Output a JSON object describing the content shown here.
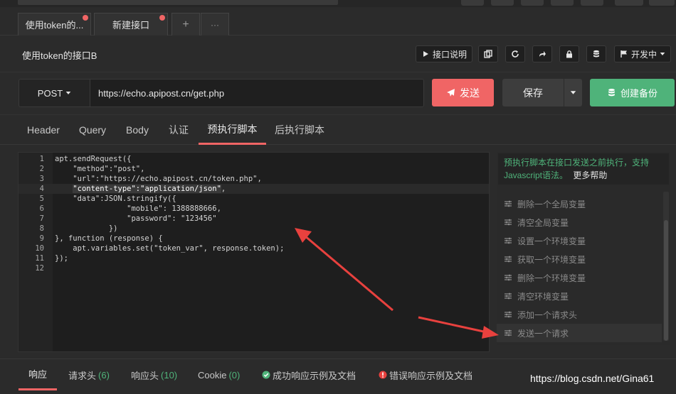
{
  "tabs": [
    {
      "label": "使用token的...",
      "modified": true
    },
    {
      "label": "新建接口",
      "modified": true
    }
  ],
  "tab_add_label": "+",
  "tab_more_label": "···",
  "request": {
    "title": "使用token的接口B",
    "method": "POST",
    "url": "https://echo.apipost.cn/get.php"
  },
  "toolbar": {
    "doc_label": "接口说明",
    "env_label": "开发中"
  },
  "actions": {
    "send_label": "发送",
    "save_label": "保存",
    "backup_label": "创建备份"
  },
  "request_tabs": [
    "Header",
    "Query",
    "Body",
    "认证",
    "预执行脚本",
    "后执行脚本"
  ],
  "active_request_tab": "预执行脚本",
  "code_lines": [
    {
      "n": "1",
      "text": "apt.sendRequest({"
    },
    {
      "n": "2",
      "text": "    \"method\":\"post\","
    },
    {
      "n": "3",
      "text": "    \"url\":\"https://echo.apipost.cn/token.php\","
    },
    {
      "n": "4",
      "pre": "    ",
      "sel": "\"content-type\":\"application/json\"",
      "post": ","
    },
    {
      "n": "5",
      "text": "    \"data\":JSON.stringify({"
    },
    {
      "n": "6",
      "text": "                \"mobile\": 1388888666,"
    },
    {
      "n": "7",
      "text": "                \"password\": \"123456\""
    },
    {
      "n": "8",
      "text": "            })"
    },
    {
      "n": "9",
      "text": "}, function (response) {"
    },
    {
      "n": "10",
      "text": "    apt.variables.set(\"token_var\", response.token);"
    },
    {
      "n": "11",
      "text": "});"
    },
    {
      "n": "12",
      "text": ""
    }
  ],
  "side": {
    "tip": "预执行脚本在接口发送之前执行，支持Javascript语法。",
    "more_help": "更多帮助",
    "snippets": [
      "删除一个全局变量",
      "清空全局变量",
      "设置一个环境变量",
      "获取一个环境变量",
      "删除一个环境变量",
      "清空环境变量",
      "添加一个请求头",
      "发送一个请求"
    ]
  },
  "response_tabs": {
    "response": "响应",
    "req_headers": "请求头",
    "req_headers_count": "(6)",
    "resp_headers": "响应头",
    "resp_headers_count": "(10)",
    "cookie": "Cookie",
    "cookie_count": "(0)",
    "success_example": "成功响应示例及文档",
    "error_example": "错误响应示例及文档"
  },
  "watermark": "https://blog.csdn.net/Gina61",
  "colors": {
    "accent": "#f06565",
    "success": "#4fb37a",
    "background": "#2b2b2b",
    "editor": "#1e1e1e"
  }
}
